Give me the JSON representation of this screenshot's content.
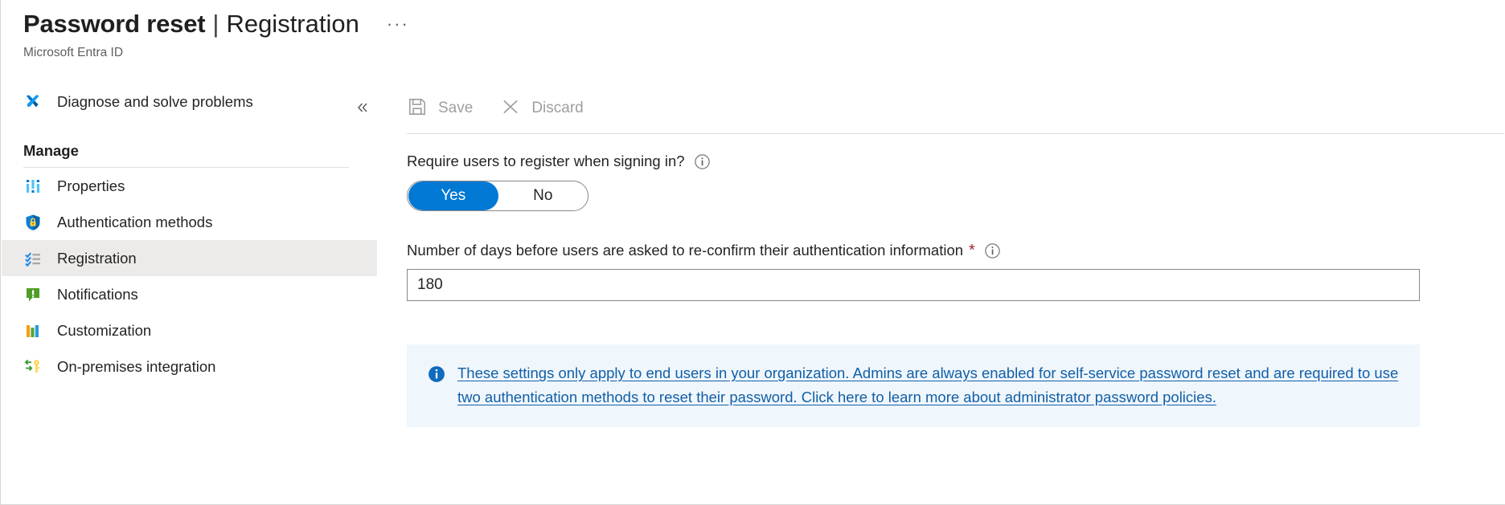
{
  "header": {
    "title_main": "Password reset",
    "title_separator": "|",
    "title_sub": "Registration",
    "ellipsis": "···",
    "subtitle": "Microsoft Entra ID"
  },
  "sidebar": {
    "collapse_icon": "double-chevron-left-icon",
    "top_items": [
      {
        "label": "Diagnose and solve problems",
        "icon": "wrench-screwdriver-icon",
        "selected": false
      }
    ],
    "section_header": "Manage",
    "manage_items": [
      {
        "label": "Properties",
        "icon": "properties-bars-icon",
        "selected": false
      },
      {
        "label": "Authentication methods",
        "icon": "shield-lock-icon",
        "selected": false
      },
      {
        "label": "Registration",
        "icon": "checklist-icon",
        "selected": true
      },
      {
        "label": "Notifications",
        "icon": "notification-alert-icon",
        "selected": false
      },
      {
        "label": "Customization",
        "icon": "color-bars-icon",
        "selected": false
      },
      {
        "label": "On-premises integration",
        "icon": "sync-key-icon",
        "selected": false
      }
    ]
  },
  "toolbar": {
    "save_label": "Save",
    "save_icon": "save-floppy-icon",
    "discard_label": "Discard",
    "discard_icon": "close-x-icon",
    "disabled_color": "#a19f9d"
  },
  "form": {
    "require_register": {
      "label": "Require users to register when signing in?",
      "info_icon": "info-circle-icon",
      "options": [
        "Yes",
        "No"
      ],
      "selected": "Yes",
      "accent_color": "#0078d4"
    },
    "reconfirm_days": {
      "label": "Number of days before users are asked to re-confirm their authentication information",
      "required_marker": "*",
      "required_color": "#a4262c",
      "info_icon": "info-circle-icon",
      "value": "180"
    }
  },
  "banner": {
    "icon": "info-filled-circle-icon",
    "text": "These settings only apply to end users in your organization. Admins are always enabled for self-service password reset and are required to use two authentication methods to reset their password. Click here to learn more about administrator password policies.",
    "background_color": "#eff6fc",
    "link_color": "#125fa7"
  }
}
